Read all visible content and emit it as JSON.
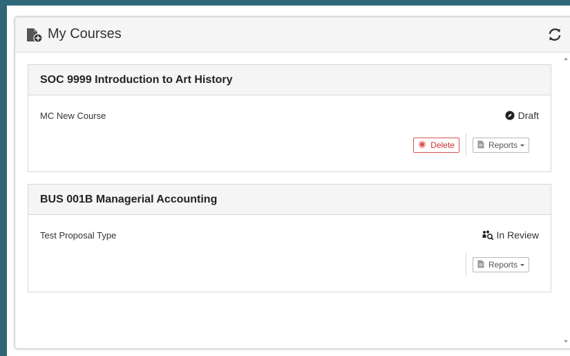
{
  "panel": {
    "title": "My Courses",
    "icons": {
      "header": "file-plus-icon",
      "refresh": "refresh-icon"
    }
  },
  "courses": [
    {
      "title": "SOC 9999 Introduction to Art History",
      "proposal_type": "MC New Course",
      "status": "Draft",
      "status_icon": "compass-icon",
      "actions": {
        "delete_label": "Delete",
        "reports_label": "Reports"
      }
    },
    {
      "title": "BUS 001B Managerial Accounting",
      "proposal_type": "Test Proposal Type",
      "status": "In Review",
      "status_icon": "review-icon",
      "actions": {
        "reports_label": "Reports"
      }
    }
  ],
  "colors": {
    "accent_teal": "#2e6878",
    "danger": "#d9534f",
    "header_bg": "#f5f5f5",
    "border": "#d6d6d6"
  }
}
